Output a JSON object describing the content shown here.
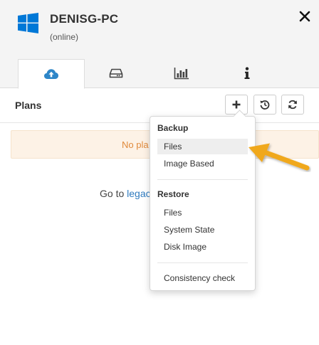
{
  "device": {
    "name": "DENISG-PC",
    "status": "(online)",
    "os_icon": "windows-logo-icon",
    "brand_color": "#0078d7"
  },
  "tabs": [
    {
      "icon": "cloud-upload-icon",
      "active": true
    },
    {
      "icon": "hard-drive-icon",
      "active": false
    },
    {
      "icon": "bar-chart-icon",
      "active": false
    },
    {
      "icon": "info-icon",
      "active": false
    }
  ],
  "plans": {
    "title": "Plans",
    "toolbar": [
      {
        "icon": "plus-icon"
      },
      {
        "icon": "history-icon"
      },
      {
        "icon": "refresh-icon"
      }
    ],
    "empty_message": "No pla",
    "goto_prefix": "Go to ",
    "goto_link": "legac"
  },
  "dropdown": {
    "backup_header": "Backup",
    "backup_items": [
      "Files",
      "Image Based"
    ],
    "restore_header": "Restore",
    "restore_items": [
      "Files",
      "System State",
      "Disk Image"
    ],
    "extra_items": [
      "Consistency check"
    ],
    "highlighted": "Files"
  },
  "colors": {
    "accent_arrow": "#f0a81e",
    "link": "#2f7bbf",
    "warning_bg": "#fdf2e6",
    "warning_text": "#e08a3c"
  }
}
